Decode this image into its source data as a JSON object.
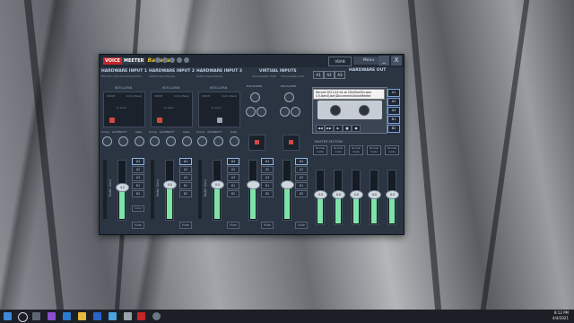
{
  "app": {
    "logo_voice": "VOICE",
    "logo_meeter": "MEETER",
    "logo_banana": "Banana",
    "vban": "VBAN",
    "menu": "Menu",
    "minimize": "_",
    "close": "X"
  },
  "hw_inputs": [
    {
      "title": "HARDWARE INPUT 1",
      "sub": "Microfon (Cloud Gaming Micro",
      "intel": "INTELLIPAN",
      "voice": "VOICE",
      "color": "Color Panel",
      "fx": "fx echo",
      "fader": "4.2",
      "mono": "mono"
    },
    {
      "title": "HARDWARE INPUT 2",
      "sub": "Select Input Device",
      "intel": "INTELLIPAN",
      "voice": "VOICE",
      "color": "Color Panel",
      "fx": "fx echo",
      "fader": "0.0",
      "mono": ""
    },
    {
      "title": "HARDWARE INPUT 3",
      "sub": "Select Input Device",
      "intel": "INTELLIPAN",
      "voice": "VOICE",
      "color": "Color Panel",
      "fx": "fx echo",
      "fader": "0.0",
      "mono": ""
    }
  ],
  "virtual": {
    "title": "VIRTUAL INPUTS",
    "v1": "Voicemeeter VAIO",
    "v2": "Voicemeeter AUX",
    "eq": "EQUALIZER"
  },
  "labels": {
    "comp": "Comp.",
    "audibility": "AUDIBILITY",
    "gate": "Gate",
    "fader_gain": "Fader Gain",
    "mute": "Mute",
    "hw_out": "HARDWARE OUT",
    "master": "MASTER SECTION"
  },
  "bus_buttons": [
    "A1",
    "A2",
    "A3",
    "B1",
    "B2"
  ],
  "bus_select": [
    "A1",
    "A2",
    "A3"
  ],
  "recorder": {
    "tip_line1": "Record 2021-04-04 at 20h45m55s.wav",
    "tip_line2": "C:\\Users\\User\\Documents\\VoiceMeeter"
  },
  "master_boxes": [
    "Normal mode",
    "Normal mode",
    "Normal mode",
    "Normal mode",
    "Normal mode"
  ],
  "master_faders": [
    "0.0",
    "0.0",
    "0.0",
    "0.0",
    "0.0"
  ],
  "taskbar": {
    "time": "8:12 PM",
    "date": "4/4/2021"
  }
}
